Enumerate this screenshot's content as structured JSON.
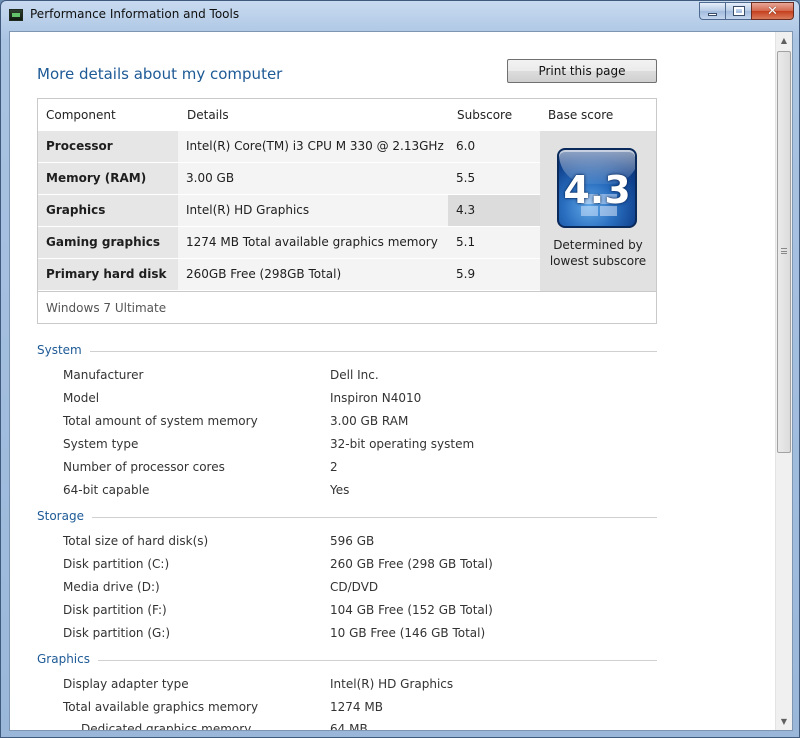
{
  "window": {
    "title": "Performance Information and Tools"
  },
  "page": {
    "title": "More details about my computer",
    "print_label": "Print this page"
  },
  "score_table": {
    "headers": {
      "component": "Component",
      "details": "Details",
      "subscore": "Subscore",
      "base_score": "Base score"
    },
    "rows": [
      {
        "component": "Processor",
        "details": "Intel(R) Core(TM) i3 CPU M 330 @ 2.13GHz",
        "subscore": "6.0"
      },
      {
        "component": "Memory (RAM)",
        "details": "3.00 GB",
        "subscore": "5.5"
      },
      {
        "component": "Graphics",
        "details": "Intel(R) HD Graphics",
        "subscore": "4.3"
      },
      {
        "component": "Gaming graphics",
        "details": "1274 MB Total available graphics memory",
        "subscore": "5.1"
      },
      {
        "component": "Primary hard disk",
        "details": "260GB Free (298GB Total)",
        "subscore": "5.9"
      }
    ],
    "base_score": "4.3",
    "base_caption_line1": "Determined by",
    "base_caption_line2": "lowest subscore",
    "os": "Windows 7 Ultimate"
  },
  "sections": {
    "system": {
      "title": "System",
      "rows": [
        {
          "label": "Manufacturer",
          "value": "Dell Inc."
        },
        {
          "label": "Model",
          "value": "Inspiron N4010"
        },
        {
          "label": "Total amount of system memory",
          "value": "3.00 GB RAM"
        },
        {
          "label": "System type",
          "value": "32-bit operating system"
        },
        {
          "label": "Number of processor cores",
          "value": "2"
        },
        {
          "label": "64-bit capable",
          "value": "Yes"
        }
      ]
    },
    "storage": {
      "title": "Storage",
      "rows": [
        {
          "label": "Total size of hard disk(s)",
          "value": "596 GB"
        },
        {
          "label": "Disk partition (C:)",
          "value": "260 GB Free (298 GB Total)"
        },
        {
          "label": "Media drive (D:)",
          "value": "CD/DVD"
        },
        {
          "label": "Disk partition (F:)",
          "value": "104 GB Free (152 GB Total)"
        },
        {
          "label": "Disk partition (G:)",
          "value": "10 GB Free (146 GB Total)"
        }
      ]
    },
    "graphics": {
      "title": "Graphics",
      "rows": [
        {
          "label": "Display adapter type",
          "value": "Intel(R) HD Graphics"
        },
        {
          "label": "Total available graphics memory",
          "value": "1274 MB"
        },
        {
          "label": "Dedicated graphics memory",
          "value": "64 MB"
        }
      ]
    }
  },
  "colors": {
    "accent": "#1e5a96",
    "badge": "#0d3e8a"
  }
}
